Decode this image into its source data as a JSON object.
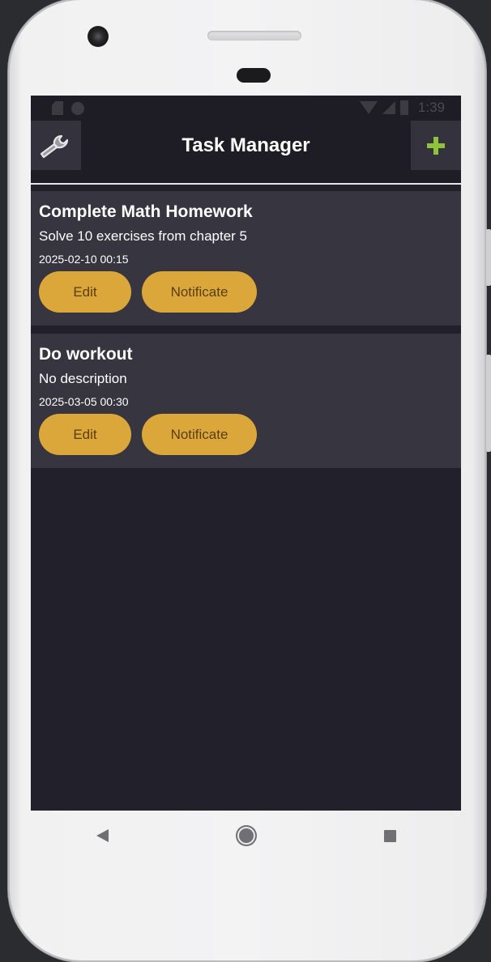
{
  "status_bar": {
    "time": "1:39"
  },
  "toolbar": {
    "title": "Task Manager",
    "settings_icon": "wrench-icon",
    "add_icon": "plus-icon",
    "add_icon_color": "#8fc43a"
  },
  "tasks": [
    {
      "title": "Complete Math Homework",
      "description": "Solve 10 exercises from chapter 5",
      "datetime": "2025-02-10 00:15",
      "edit_label": "Edit",
      "notify_label": "Notificate"
    },
    {
      "title": "Do workout",
      "description": "No description",
      "datetime": "2025-03-05 00:30",
      "edit_label": "Edit",
      "notify_label": "Notificate"
    }
  ],
  "colors": {
    "background": "#22212b",
    "card": "#363540",
    "button": "#dba63a",
    "button_text": "#5a3f0c"
  },
  "nav": {
    "back_icon": "back-triangle-icon",
    "home_icon": "home-circle-icon",
    "recents_icon": "recents-square-icon"
  }
}
